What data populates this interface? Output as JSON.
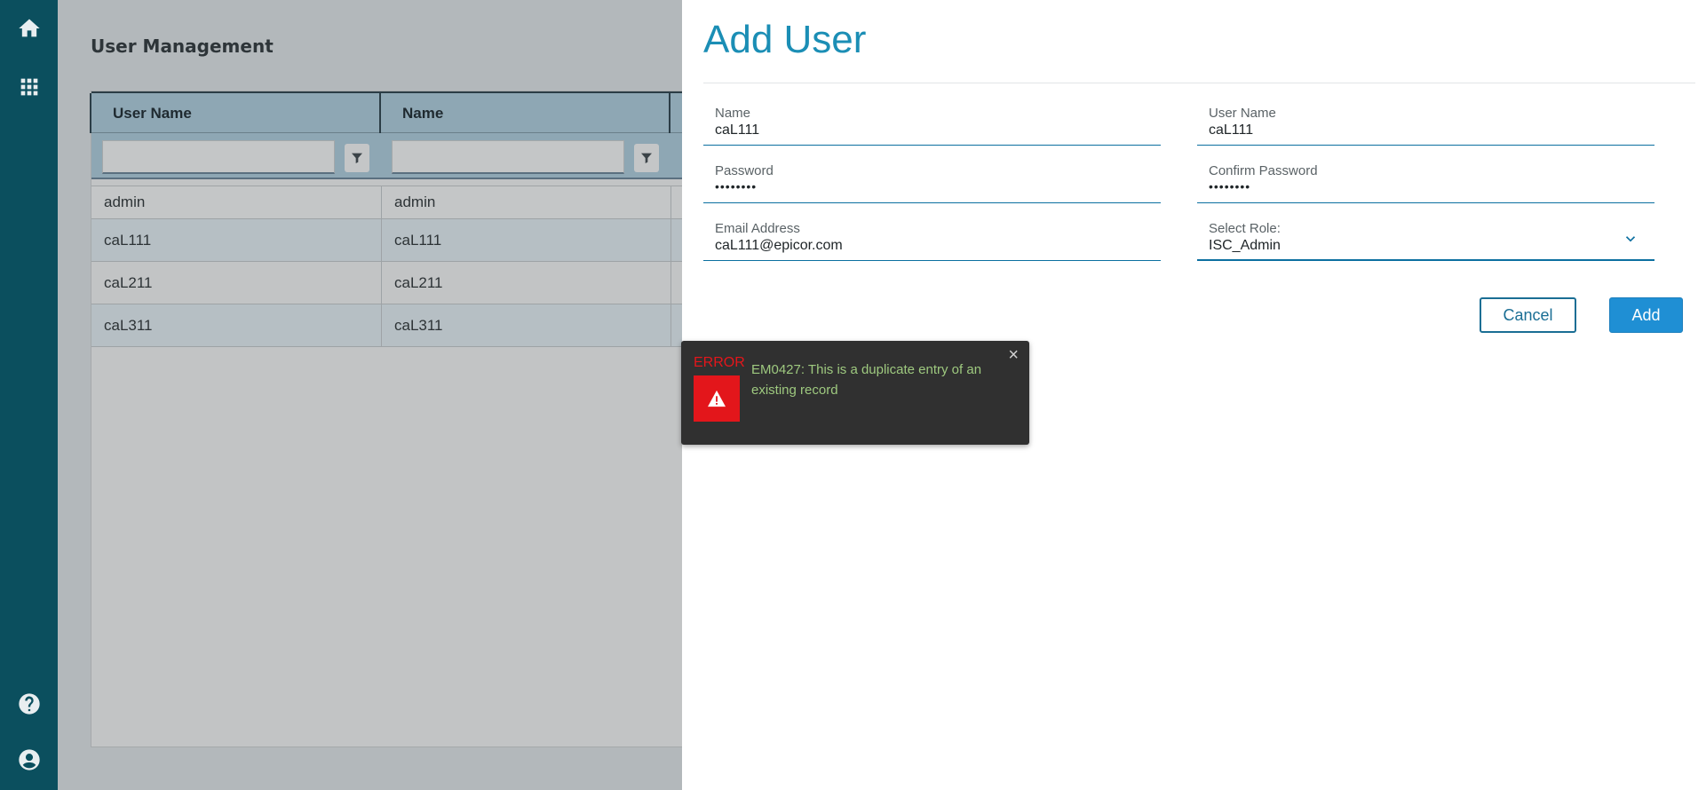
{
  "rail": {
    "top_icons": [
      "home-icon",
      "apps-grid-icon"
    ],
    "bottom_icons": [
      "help-icon",
      "account-icon"
    ],
    "bg_color": "#0b4f5e"
  },
  "page": {
    "title": "User Management",
    "grid": {
      "columns": [
        "User Name",
        "Name"
      ],
      "rows": [
        [
          "admin",
          "admin"
        ],
        [
          "caL111",
          "caL111"
        ],
        [
          "caL211",
          "caL211"
        ],
        [
          "caL311",
          "caL311"
        ]
      ]
    }
  },
  "drawer": {
    "title": "Add User",
    "fields": {
      "name": {
        "label": "Name",
        "value": "caL111"
      },
      "username": {
        "label": "User Name",
        "value": "caL111"
      },
      "password": {
        "label": "Password",
        "value": "••••••••"
      },
      "confirm_password": {
        "label": "Confirm Password",
        "value": "••••••••"
      },
      "email": {
        "label": "Email Address",
        "value": "caL111@epicor.com"
      },
      "role": {
        "label": "Select Role:",
        "value": "ISC_Admin"
      }
    },
    "buttons": {
      "cancel": "Cancel",
      "add": "Add"
    },
    "accent_color": "#1b8eb5"
  },
  "toast": {
    "type_label": "ERROR",
    "message": "EM0427: This is a duplicate entry of an existing record",
    "close": "×",
    "colors": {
      "error": "#e3161b",
      "message": "#9ec97f",
      "bg": "#303030"
    }
  }
}
